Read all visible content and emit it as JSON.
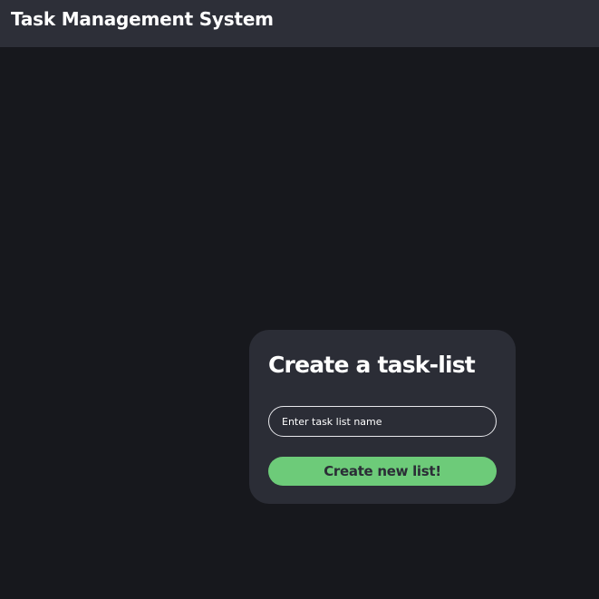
{
  "header": {
    "title": "Task Management System"
  },
  "create_card": {
    "title": "Create a task-list",
    "input_placeholder": "Enter task list name",
    "input_value": "",
    "submit_label": "Create new list!"
  },
  "colors": {
    "page_background": "#17181d",
    "header_background": "#2d2f38",
    "card_background": "#2b2d36",
    "accent_green": "#6dcb79",
    "text_primary": "#ffffff"
  }
}
